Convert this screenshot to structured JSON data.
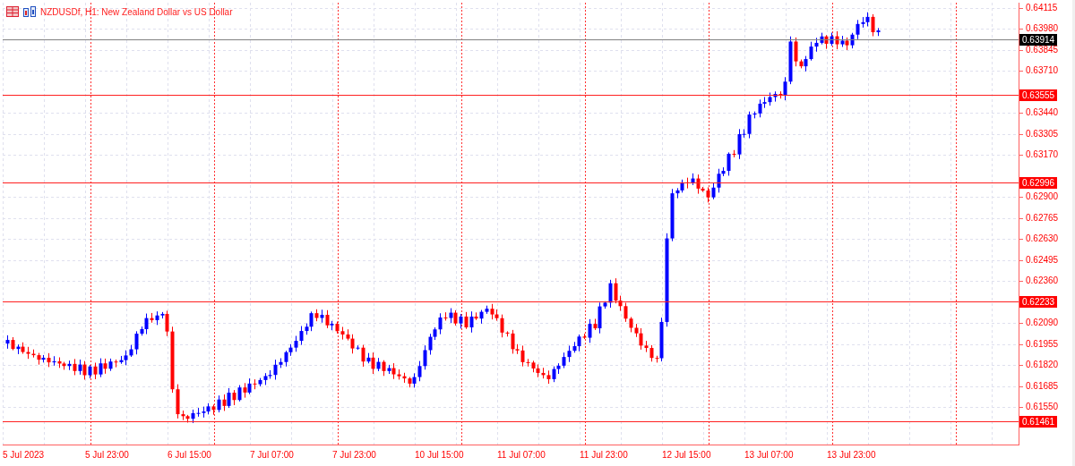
{
  "chart": {
    "title": "NZDUSDf, H1: New Zealand Dollar vs US Dollar",
    "price_axis": [
      "0.64115",
      "0.63980",
      "0.63845",
      "0.63710",
      "0.63440",
      "0.63305",
      "0.63170",
      "0.62900",
      "0.62765",
      "0.62630",
      "0.62495",
      "0.62360",
      "0.62090",
      "0.61955",
      "0.61820",
      "0.61685",
      "0.61550"
    ],
    "levels": [
      {
        "price": "0.63914",
        "kind": "current"
      },
      {
        "price": "0.63555",
        "kind": "level"
      },
      {
        "price": "0.62996",
        "kind": "level"
      },
      {
        "price": "0.62233",
        "kind": "level"
      },
      {
        "price": "0.61461",
        "kind": "level"
      }
    ],
    "time_axis": [
      "5 Jul 2023",
      "5 Jul 23:00",
      "6 Jul 15:00",
      "7 Jul 07:00",
      "7 Jul 23:00",
      "10 Jul 15:00",
      "11 Jul 07:00",
      "11 Jul 23:00",
      "12 Jul 15:00",
      "13 Jul 07:00",
      "13 Jul 23:00"
    ]
  }
}
